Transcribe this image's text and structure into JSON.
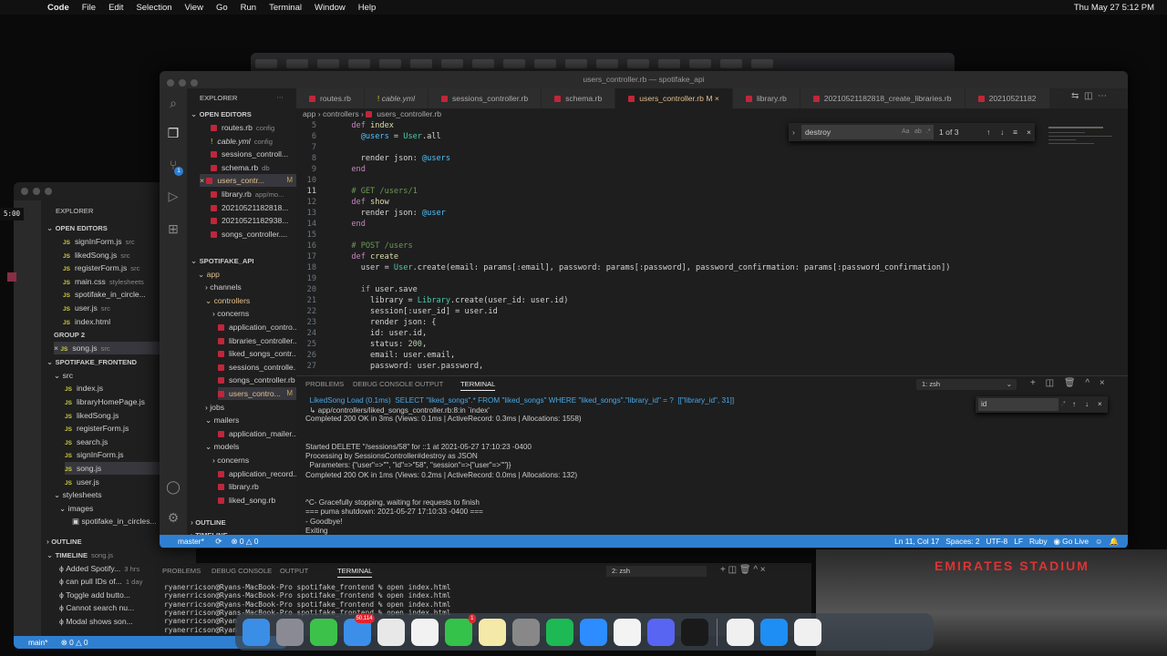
{
  "menubar": {
    "app": "Code",
    "items": [
      "File",
      "Edit",
      "Selection",
      "View",
      "Go",
      "Run",
      "Terminal",
      "Window",
      "Help"
    ],
    "clock": "Thu May 27  5:12 PM"
  },
  "back_window": {
    "explorer": "EXPLORER",
    "open_editors": "OPEN EDITORS",
    "editors": [
      [
        "signInForm.js",
        "src"
      ],
      [
        "likedSong.js",
        "src"
      ],
      [
        "registerForm.js",
        "src"
      ],
      [
        "main.css",
        "stylesheets"
      ],
      [
        "spotifake_in_circle...",
        ""
      ],
      [
        "user.js",
        "src"
      ],
      [
        "index.html",
        ""
      ]
    ],
    "group2": "GROUP 2",
    "group2_item": [
      "song.js",
      "src"
    ],
    "project": "SPOTIFAKE_FRONTEND",
    "src": "src",
    "files": [
      [
        "index.js",
        "M"
      ],
      [
        "libraryHomePage.js",
        ""
      ],
      [
        "likedSong.js",
        ""
      ],
      [
        "registerForm.js",
        ""
      ],
      [
        "search.js",
        ""
      ],
      [
        "signInForm.js",
        ""
      ],
      [
        "song.js",
        ""
      ],
      [
        "user.js",
        ""
      ]
    ],
    "stylesheets": "stylesheets",
    "images": "images",
    "image_file": "spotifake_in_circles...",
    "outline": "OUTLINE",
    "timeline": "TIMELINE",
    "timeline_file": "song.js",
    "timeline_items": [
      [
        "Added Spotify...",
        "3 hrs"
      ],
      [
        "can pull IDs of...",
        "1 day"
      ],
      [
        "Toggle add butto...",
        ""
      ],
      [
        "Cannot search nu...",
        ""
      ],
      [
        "Modal shows son...",
        ""
      ]
    ],
    "status": {
      "branch": "main*",
      "errors": "0",
      "warnings": "0"
    },
    "timer": "5:00",
    "panel_tabs": [
      "PROBLEMS",
      "DEBUG CONSOLE",
      "OUTPUT",
      "TERMINAL"
    ],
    "terminal_select": "2: zsh",
    "terminal_lines": [
      "ryanerricson@Ryans-MacBook-Pro spotifake_frontend % open index.html",
      "ryanerricson@Ryans-MacBook-Pro spotifake_frontend % open index.html",
      "ryanerricson@Ryans-MacBook-Pro spotifake_frontend % open index.html",
      "ryanerricson@Ryans-MacBook-Pro spotifake_frontend % open index.html",
      "ryanerricson@Ryan",
      "ryanerricson@Ryan"
    ]
  },
  "front_window": {
    "title": "users_controller.rb — spotifake_api",
    "explorer": "EXPLORER",
    "open_editors": "OPEN EDITORS",
    "editors": [
      [
        "routes.rb",
        "config",
        "rb"
      ],
      [
        "cable.yml",
        "config",
        "yml"
      ],
      [
        "sessions_controll...",
        "",
        "rb"
      ],
      [
        "schema.rb",
        "db",
        "rb"
      ],
      [
        "users_contr...",
        "M",
        "rb"
      ],
      [
        "library.rb",
        "app/mo...",
        "rb"
      ],
      [
        "20210521182818...",
        "",
        "rb"
      ],
      [
        "20210521182938...",
        "",
        "rb"
      ],
      [
        "songs_controller....",
        "",
        "rb"
      ]
    ],
    "project": "SPOTIFAKE_API",
    "tree": [
      [
        "app",
        1,
        "v"
      ],
      [
        "channels",
        2,
        ">"
      ],
      [
        "controllers",
        2,
        "v"
      ],
      [
        "concerns",
        3,
        ">"
      ],
      [
        "application_contro...",
        3,
        "rb"
      ],
      [
        "libraries_controller...",
        3,
        "rb"
      ],
      [
        "liked_songs_contr...",
        3,
        "rb"
      ],
      [
        "sessions_controlle...",
        3,
        "rb"
      ],
      [
        "songs_controller.rb",
        3,
        "rb"
      ],
      [
        "users_contro...",
        3,
        "rb"
      ],
      [
        "jobs",
        2,
        ">"
      ],
      [
        "mailers",
        2,
        "v"
      ],
      [
        "application_mailer...",
        3,
        "rb"
      ],
      [
        "models",
        2,
        "v"
      ],
      [
        "concerns",
        3,
        ">"
      ],
      [
        "application_record...",
        3,
        "rb"
      ],
      [
        "library.rb",
        3,
        "rb"
      ],
      [
        "liked_song.rb",
        3,
        "rb"
      ]
    ],
    "outline": "OUTLINE",
    "timeline": "TIMELINE",
    "tabs": [
      "routes.rb",
      "cable.yml",
      "sessions_controller.rb",
      "schema.rb",
      "users_controller.rb",
      "library.rb",
      "20210521182818_create_libraries.rb",
      "20210521182"
    ],
    "active_tab": "users_controller.rb",
    "active_tab_badge": "M",
    "breadcrumb": [
      "app",
      "controllers",
      "users_controller.rb"
    ],
    "code": [
      [
        5,
        [
          [
            "  "
          ],
          [
            "def ",
            "k"
          ],
          [
            "index",
            "f"
          ]
        ]
      ],
      [
        6,
        [
          [
            "    "
          ],
          [
            "@users",
            "v"
          ],
          [
            " = "
          ],
          [
            "User",
            "c"
          ],
          [
            ".all"
          ]
        ]
      ],
      [
        7,
        [
          [
            ""
          ]
        ]
      ],
      [
        8,
        [
          [
            "    render json: "
          ],
          [
            "@users",
            "v"
          ]
        ]
      ],
      [
        9,
        [
          [
            "  "
          ],
          [
            "end",
            "k"
          ]
        ]
      ],
      [
        10,
        [
          [
            ""
          ]
        ]
      ],
      [
        11,
        [
          [
            "  "
          ],
          [
            "# GET /users/1",
            "cm"
          ]
        ]
      ],
      [
        12,
        [
          [
            "  "
          ],
          [
            "def ",
            "k"
          ],
          [
            "show",
            "f"
          ]
        ]
      ],
      [
        13,
        [
          [
            "    render json: "
          ],
          [
            "@user",
            "v"
          ]
        ]
      ],
      [
        14,
        [
          [
            "  "
          ],
          [
            "end",
            "k"
          ]
        ]
      ],
      [
        15,
        [
          [
            ""
          ]
        ]
      ],
      [
        16,
        [
          [
            "  "
          ],
          [
            "# POST /users",
            "cm"
          ]
        ]
      ],
      [
        17,
        [
          [
            "  "
          ],
          [
            "def ",
            "k"
          ],
          [
            "create",
            "f"
          ]
        ]
      ],
      [
        18,
        [
          [
            "    user = "
          ],
          [
            "User",
            "c"
          ],
          [
            ".create(email: params[:email], password: params[:password], password_confirmation: params[:password_confirmation])"
          ]
        ]
      ],
      [
        19,
        [
          [
            ""
          ]
        ]
      ],
      [
        20,
        [
          [
            "    "
          ],
          [
            "if ",
            "k"
          ],
          [
            "user.save"
          ]
        ]
      ],
      [
        21,
        [
          [
            "      library = "
          ],
          [
            "Library",
            "c"
          ],
          [
            ".create(user_id: user.id)"
          ]
        ]
      ],
      [
        22,
        [
          [
            "      session[:user_id] = user.id"
          ]
        ]
      ],
      [
        23,
        [
          [
            "      render json: {"
          ]
        ]
      ],
      [
        24,
        [
          [
            "      id: user.id,"
          ]
        ]
      ],
      [
        25,
        [
          [
            "      status: "
          ],
          [
            "200",
            "n"
          ],
          [
            ","
          ]
        ]
      ],
      [
        26,
        [
          [
            "      email: user.email,"
          ]
        ]
      ],
      [
        27,
        [
          [
            "      password: user.password,"
          ]
        ]
      ]
    ],
    "find": {
      "value": "destroy",
      "result": "1 of 3"
    },
    "panel_tabs": [
      "PROBLEMS",
      "DEBUG CONSOLE",
      "OUTPUT",
      "TERMINAL"
    ],
    "terminal_select": "1: zsh",
    "terminal_find": "id",
    "terminal_lines": [
      [
        "  LikedSong Load (0.1ms)  SELECT \"liked_songs\".* FROM \"liked_songs\" WHERE \"liked_songs\".\"library_id\" = ?  [[\"library_id\", 31]]",
        "sql"
      ],
      [
        "  ↳ app/controllers/liked_songs_controller.rb:8:in `index'",
        ""
      ],
      [
        "Completed 200 OK in 3ms (Views: 0.1ms | ActiveRecord: 0.3ms | Allocations: 1558)",
        ""
      ],
      [
        "",
        ""
      ],
      [
        "",
        ""
      ],
      [
        "Started DELETE \"/sessions/58\" for ::1 at 2021-05-27 17:10:23 -0400",
        ""
      ],
      [
        "Processing by SessionsController#destroy as JSON",
        ""
      ],
      [
        "  Parameters: {\"user\"=>\"\", \"id\"=>\"58\", \"session\"=>{\"user\"=>\"\"}}",
        ""
      ],
      [
        "Completed 200 OK in 1ms (Views: 0.2ms | ActiveRecord: 0.0ms | Allocations: 132)",
        ""
      ],
      [
        "",
        ""
      ],
      [
        "",
        ""
      ],
      [
        "^C- Gracefully stopping, waiting for requests to finish",
        ""
      ],
      [
        "=== puma shutdown: 2021-05-27 17:10:33 -0400 ===",
        ""
      ],
      [
        "- Goodbye!",
        ""
      ],
      [
        "Exiting",
        ""
      ],
      [
        "ryanerricson@Ryans-MacBook-Pro spotifake_api % ▯",
        ""
      ]
    ],
    "status": {
      "branch": "master*",
      "errors": "0",
      "warnings": "0",
      "position": "Ln 11, Col 17",
      "spaces": "Spaces: 2",
      "encoding": "UTF-8",
      "eol": "LF",
      "language": "Ruby",
      "golive": "Go Live"
    }
  },
  "dock": {
    "apps": [
      [
        "finder-icon",
        "#3a8ee6",
        ""
      ],
      [
        "launchpad-icon",
        "#8a8a95",
        ""
      ],
      [
        "messages-icon",
        "#3cc24a",
        ""
      ],
      [
        "mail-icon",
        "#3b8fe8",
        "50,114"
      ],
      [
        "chrome-icon",
        "#e8e8e8",
        ""
      ],
      [
        "photos-icon",
        "#f2f2f2",
        ""
      ],
      [
        "facetime-icon",
        "#35c24a",
        "1"
      ],
      [
        "notes-icon",
        "#f5e9a8",
        ""
      ],
      [
        "system-preferences-icon",
        "#888",
        ""
      ],
      [
        "spotify-icon",
        "#1db954",
        ""
      ],
      [
        "zoom-icon",
        "#2d8cff",
        ""
      ],
      [
        "slack-icon",
        "#f3f3f3",
        ""
      ],
      [
        "discord-icon",
        "#5865f2",
        ""
      ],
      [
        "terminal-icon",
        "#1a1a1a",
        ""
      ],
      [
        "vscode-icon",
        "#f0f0f0",
        ""
      ],
      [
        "app-store-icon",
        "#1e8ef5",
        ""
      ],
      [
        "vscode-insiders-icon",
        "#f0f0f0",
        ""
      ]
    ]
  },
  "colors": {
    "statusbar": "#2f7fd0",
    "editor_bg": "#1e1e1e",
    "ruby_icon": "#c0263a"
  }
}
